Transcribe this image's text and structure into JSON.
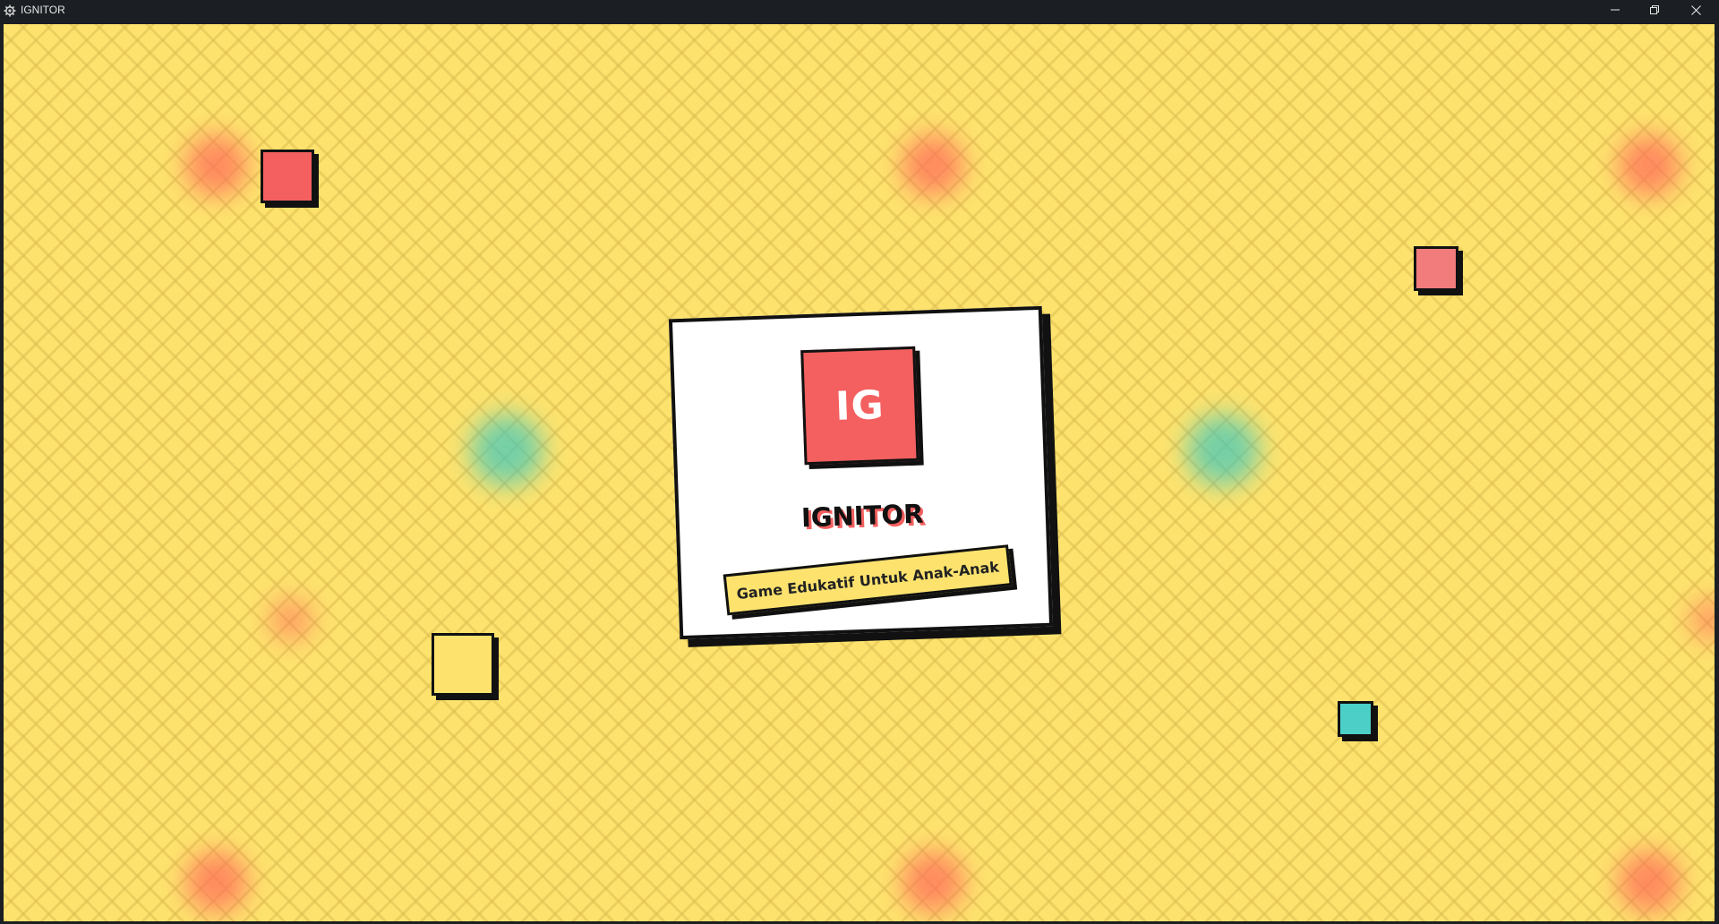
{
  "window": {
    "title": "IGNITOR",
    "icon": "gear-icon",
    "controls": {
      "minimize": "minimize-icon",
      "restore": "restore-icon",
      "close": "close-icon"
    }
  },
  "splash": {
    "logo_text": "IG",
    "app_name": "IGNITOR",
    "tagline": "Game Edukatif Untuk Anak-Anak"
  },
  "colors": {
    "background": "#fde36e",
    "pattern": "#debe50",
    "accent_red": "#f45f5f",
    "accent_pink": "#f27b7b",
    "accent_teal": "#4ccfc6",
    "outline": "#111111",
    "card": "#ffffff"
  }
}
